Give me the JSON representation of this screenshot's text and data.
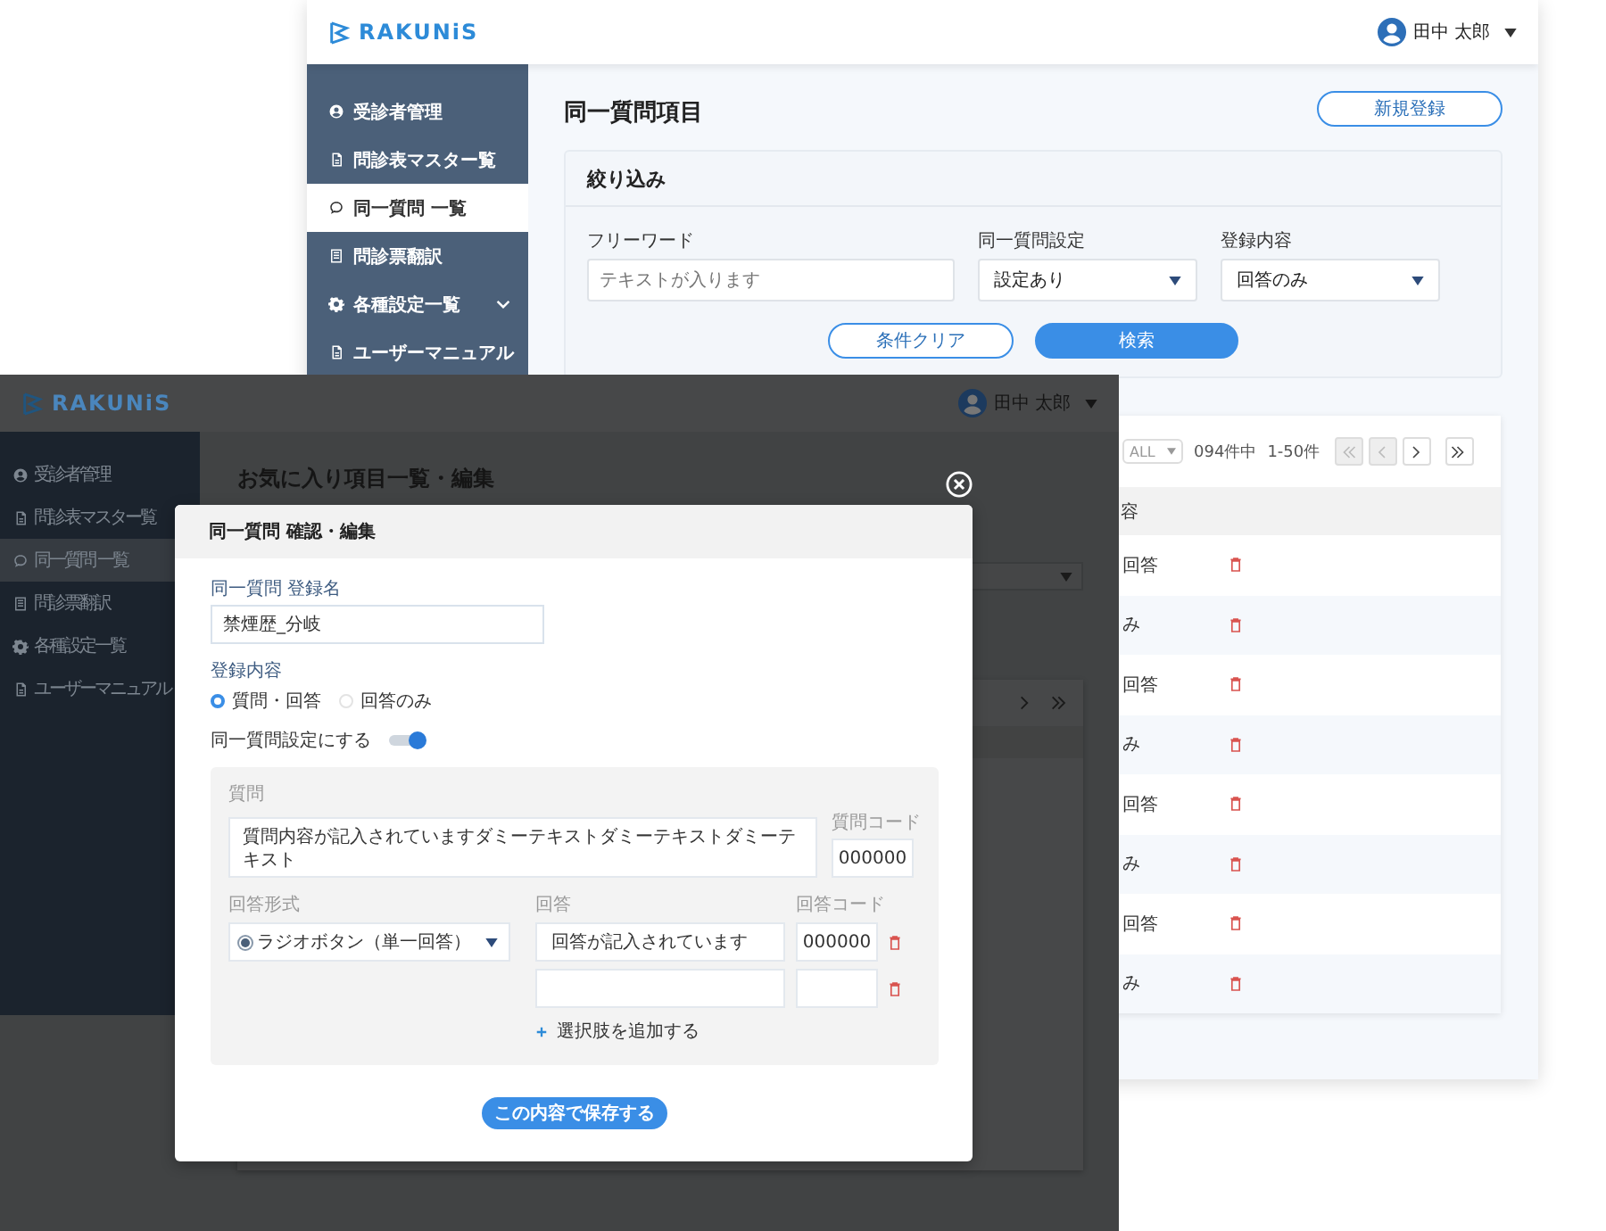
{
  "back_window": {
    "logo": "RAKUNiS",
    "user": "田中 太郎",
    "sidebar": {
      "items": [
        {
          "label": "受診者管理",
          "selected": false,
          "kind": "link"
        },
        {
          "label": "問診表マスター覧",
          "selected": false,
          "kind": "link"
        },
        {
          "label": "同一質問 一覧",
          "selected": true,
          "kind": "link"
        },
        {
          "label": "問診票翻訳",
          "selected": false,
          "kind": "link"
        },
        {
          "label": "各種設定一覧",
          "selected": false,
          "kind": "group"
        },
        {
          "label": "ユーザーマニュアル",
          "selected": false,
          "kind": "link"
        }
      ]
    },
    "page_title": "同一質問項目",
    "new_button": "新規登録",
    "filter": {
      "title": "絞り込み",
      "fields": [
        {
          "label": "フリーワード",
          "kind": "text",
          "placeholder": "テキストが入ります"
        },
        {
          "label": "同一質問設定",
          "kind": "select",
          "value": "設定あり"
        },
        {
          "label": "登録内容",
          "kind": "select",
          "value": "回答のみ"
        }
      ],
      "buttons": [
        {
          "label": "条件クリア",
          "kind": "outline"
        },
        {
          "label": "検索",
          "kind": "primary"
        }
      ]
    },
    "table": {
      "per_page": "ALL",
      "count": "094件中",
      "range": "1-50件",
      "pager": [
        {
          "kind": "first",
          "disabled": true
        },
        {
          "kind": "prev",
          "disabled": true
        },
        {
          "kind": "next",
          "disabled": false
        },
        {
          "kind": "last",
          "disabled": false
        }
      ],
      "columns": [
        "容"
      ],
      "rows": [
        {
          "cell": "回答"
        },
        {
          "cell": "み"
        },
        {
          "cell": "回答"
        },
        {
          "cell": "み"
        },
        {
          "cell": "回答"
        },
        {
          "cell": "み"
        },
        {
          "cell": "回答"
        },
        {
          "cell": "み"
        }
      ]
    }
  },
  "front_window": {
    "logo": "RAKUNiS",
    "user": "田中 太郎",
    "sidebar": {
      "items": [
        {
          "label": "受診者管理",
          "selected": false
        },
        {
          "label": "問診表マスター覧",
          "selected": false
        },
        {
          "label": "同一質問 一覧",
          "selected": true
        },
        {
          "label": "問診票翻訳",
          "selected": false
        },
        {
          "label": "各種設定一覧",
          "selected": false
        },
        {
          "label": "ユーザーマニュアル",
          "selected": false
        }
      ]
    },
    "page_title": "お気に入り項目一覧・編集",
    "modal": {
      "title": "同一質問 確認・編集",
      "name_label": "同一質問 登録名",
      "name_value": "禁煙歴_分岐",
      "content_label": "登録内容",
      "content_options": [
        {
          "label": "質問・回答",
          "selected": true
        },
        {
          "label": "回答のみ",
          "selected": false
        }
      ],
      "toggle": {
        "label": "同一質問設定にする",
        "on": true
      },
      "question": {
        "label": "質問",
        "text": "質問内容が記入されていますダミーテキストダミーテキストダミーテキスト",
        "code_label": "質問コード",
        "code": "000000"
      },
      "answer_format": {
        "label": "回答形式",
        "value": "ラジオボタン（単一回答）"
      },
      "answers_label": "回答",
      "answer_code_label": "回答コード",
      "answers": [
        {
          "text": "回答が記入されています",
          "code": "000000"
        }
      ],
      "add_option": "選択肢を追加する",
      "save": "この内容で保存する"
    }
  }
}
